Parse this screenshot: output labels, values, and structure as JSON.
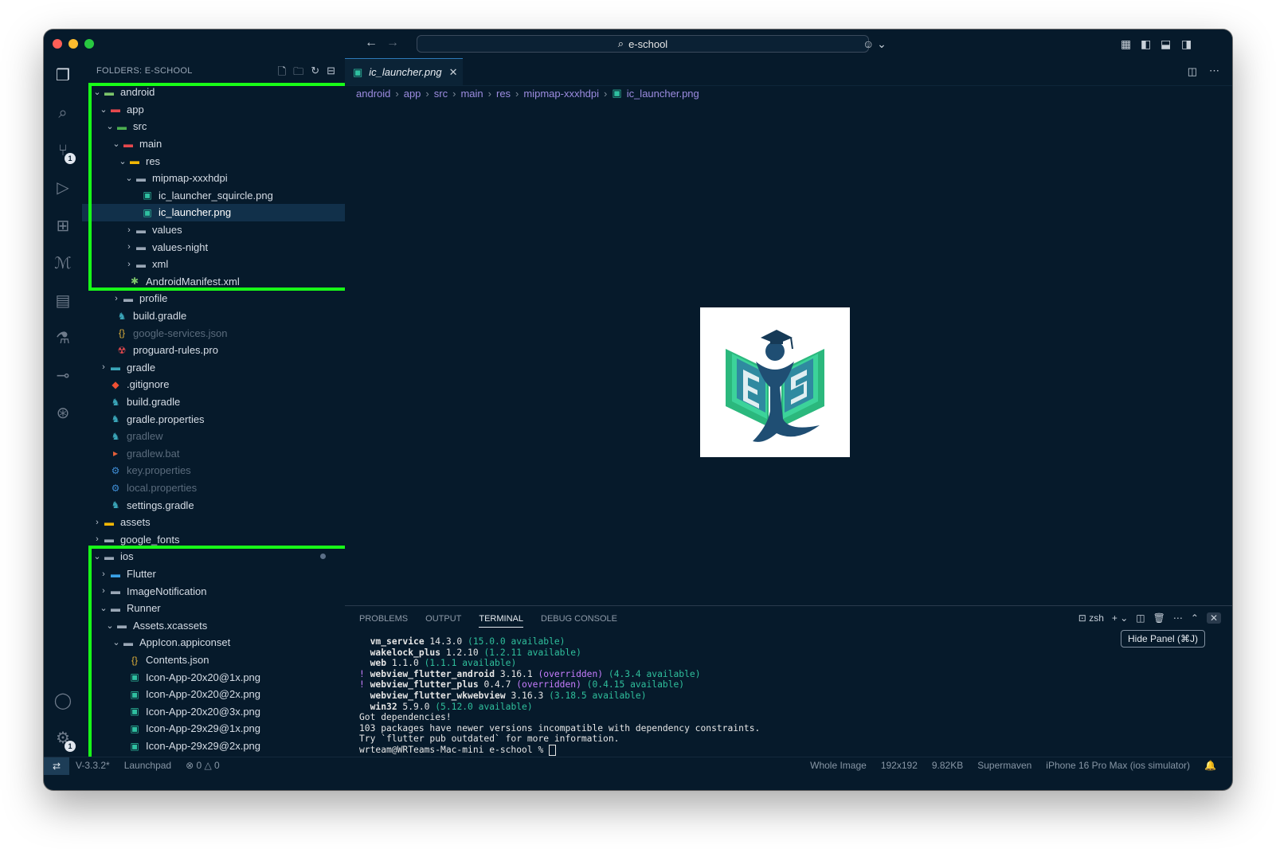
{
  "window": {
    "search_text": "e-school",
    "sidebar_title": "FOLDERS: E-SCHOOL"
  },
  "activity_badges": {
    "scm": "1",
    "settings": "1"
  },
  "tree": [
    {
      "label": "android",
      "depth": 0,
      "chev": "open",
      "icon": "folder-android-icon",
      "color": "#d6dde6"
    },
    {
      "label": "app",
      "depth": 1,
      "chev": "open",
      "icon": "folder-app-icon",
      "color": "#d6dde6"
    },
    {
      "label": "src",
      "depth": 2,
      "chev": "open",
      "icon": "folder-src-icon",
      "color": "#d6dde6"
    },
    {
      "label": "main",
      "depth": 3,
      "chev": "open",
      "icon": "folder-main-icon",
      "color": "#d6dde6"
    },
    {
      "label": "res",
      "depth": 4,
      "chev": "open",
      "icon": "folder-res-icon",
      "color": "#d6dde6"
    },
    {
      "label": "mipmap-xxxhdpi",
      "depth": 5,
      "chev": "open",
      "icon": "folder-icon",
      "color": "#d6dde6"
    },
    {
      "label": "ic_launcher_squircle.png",
      "depth": 6,
      "chev": "none",
      "icon": "image-file-icon",
      "color": "#d6dde6"
    },
    {
      "label": "ic_launcher.png",
      "depth": 6,
      "chev": "none",
      "icon": "image-file-icon",
      "color": "#ffffff",
      "selected": true
    },
    {
      "label": "values",
      "depth": 5,
      "chev": "closed",
      "icon": "folder-icon",
      "color": "#d6dde6"
    },
    {
      "label": "values-night",
      "depth": 5,
      "chev": "closed",
      "icon": "folder-icon",
      "color": "#d6dde6"
    },
    {
      "label": "xml",
      "depth": 5,
      "chev": "closed",
      "icon": "folder-icon",
      "color": "#d6dde6"
    },
    {
      "label": "AndroidManifest.xml",
      "depth": 4,
      "chev": "none",
      "icon": "android-icon",
      "color": "#d6dde6"
    },
    {
      "label": "profile",
      "depth": 3,
      "chev": "closed",
      "icon": "folder-icon",
      "color": "#d6dde6"
    },
    {
      "label": "build.gradle",
      "depth": 2,
      "chev": "none",
      "icon": "gradle-icon",
      "color": "#d6dde6"
    },
    {
      "label": "google-services.json",
      "depth": 2,
      "chev": "none",
      "icon": "json-icon",
      "color": "#5a6b7c"
    },
    {
      "label": "proguard-rules.pro",
      "depth": 2,
      "chev": "none",
      "icon": "proguard-icon",
      "color": "#d6dde6"
    },
    {
      "label": "gradle",
      "depth": 1,
      "chev": "closed",
      "icon": "folder-gradle-icon",
      "color": "#d6dde6"
    },
    {
      "label": ".gitignore",
      "depth": 1,
      "chev": "none",
      "icon": "git-icon",
      "color": "#d6dde6"
    },
    {
      "label": "build.gradle",
      "depth": 1,
      "chev": "none",
      "icon": "gradle-icon",
      "color": "#d6dde6"
    },
    {
      "label": "gradle.properties",
      "depth": 1,
      "chev": "none",
      "icon": "gradle-icon",
      "color": "#d6dde6"
    },
    {
      "label": "gradlew",
      "depth": 1,
      "chev": "none",
      "icon": "gradle-icon",
      "color": "#5a6b7c"
    },
    {
      "label": "gradlew.bat",
      "depth": 1,
      "chev": "none",
      "icon": "terminal-file-icon",
      "color": "#5a6b7c"
    },
    {
      "label": "key.properties",
      "depth": 1,
      "chev": "none",
      "icon": "settings-file-icon",
      "color": "#5a6b7c"
    },
    {
      "label": "local.properties",
      "depth": 1,
      "chev": "none",
      "icon": "settings-file-icon",
      "color": "#5a6b7c"
    },
    {
      "label": "settings.gradle",
      "depth": 1,
      "chev": "none",
      "icon": "gradle-icon",
      "color": "#d6dde6"
    },
    {
      "label": "assets",
      "depth": 0,
      "chev": "closed",
      "icon": "folder-assets-icon",
      "color": "#d6dde6"
    },
    {
      "label": "google_fonts",
      "depth": 0,
      "chev": "closed",
      "icon": "folder-icon",
      "color": "#d6dde6"
    },
    {
      "label": "ios",
      "depth": 0,
      "chev": "open",
      "icon": "folder-ios-icon",
      "color": "#d6dde6",
      "dot": true
    },
    {
      "label": "Flutter",
      "depth": 1,
      "chev": "closed",
      "icon": "folder-flutter-icon",
      "color": "#d6dde6"
    },
    {
      "label": "ImageNotification",
      "depth": 1,
      "chev": "closed",
      "icon": "folder-icon",
      "color": "#d6dde6"
    },
    {
      "label": "Runner",
      "depth": 1,
      "chev": "open",
      "icon": "folder-icon",
      "color": "#d6dde6"
    },
    {
      "label": "Assets.xcassets",
      "depth": 2,
      "chev": "open",
      "icon": "folder-icon",
      "color": "#d6dde6"
    },
    {
      "label": "AppIcon.appiconset",
      "depth": 3,
      "chev": "open",
      "icon": "folder-icon",
      "color": "#d6dde6"
    },
    {
      "label": "Contents.json",
      "depth": 4,
      "chev": "none",
      "icon": "json-icon",
      "color": "#d6dde6"
    },
    {
      "label": "Icon-App-20x20@1x.png",
      "depth": 4,
      "chev": "none",
      "icon": "image-file-icon",
      "color": "#d6dde6"
    },
    {
      "label": "Icon-App-20x20@2x.png",
      "depth": 4,
      "chev": "none",
      "icon": "image-file-icon",
      "color": "#d6dde6"
    },
    {
      "label": "Icon-App-20x20@3x.png",
      "depth": 4,
      "chev": "none",
      "icon": "image-file-icon",
      "color": "#d6dde6"
    },
    {
      "label": "Icon-App-29x29@1x.png",
      "depth": 4,
      "chev": "none",
      "icon": "image-file-icon",
      "color": "#d6dde6"
    },
    {
      "label": "Icon-App-29x29@2x.png",
      "depth": 4,
      "chev": "none",
      "icon": "image-file-icon",
      "color": "#d6dde6"
    }
  ],
  "editor": {
    "tab_label": "ic_launcher.png",
    "breadcrumb": [
      "android",
      "app",
      "src",
      "main",
      "res",
      "mipmap-xxxhdpi",
      "ic_launcher.png"
    ]
  },
  "panel": {
    "tabs": [
      "PROBLEMS",
      "OUTPUT",
      "TERMINAL",
      "DEBUG CONSOLE"
    ],
    "active_tab": "TERMINAL",
    "shell": "zsh",
    "tooltip": "Hide Panel (⌘J)",
    "terminal_lines": [
      {
        "prefix": "  ",
        "pkg": "vm_service",
        "ver": " 14.3.0 ",
        "over": "",
        "avail": "(15.0.0 available)"
      },
      {
        "prefix": "  ",
        "pkg": "wakelock_plus",
        "ver": " 1.2.10 ",
        "over": "",
        "avail": "(1.2.11 available)"
      },
      {
        "prefix": "  ",
        "pkg": "web",
        "ver": " 1.1.0 ",
        "over": "",
        "avail": "(1.1.1 available)"
      },
      {
        "prefix": "! ",
        "pkg": "webview_flutter_android",
        "ver": " 3.16.1 ",
        "over": "(overridden) ",
        "avail": "(4.3.4 available)"
      },
      {
        "prefix": "! ",
        "pkg": "webview_flutter_plus",
        "ver": " 0.4.7 ",
        "over": "(overridden) ",
        "avail": "(0.4.15 available)"
      },
      {
        "prefix": "  ",
        "pkg": "webview_flutter_wkwebview",
        "ver": " 3.16.3 ",
        "over": "",
        "avail": "(3.18.5 available)"
      },
      {
        "prefix": "  ",
        "pkg": "win32",
        "ver": " 5.9.0 ",
        "over": "",
        "avail": "(5.12.0 available)"
      }
    ],
    "plain_lines": [
      "Got dependencies!",
      "103 packages have newer versions incompatible with dependency constraints.",
      "Try `flutter pub outdated` for more information.",
      "wrteam@WRTeams-Mac-mini e-school % "
    ]
  },
  "status": {
    "left": [
      "V-3.3.2*",
      "Launchpad",
      "⊗ 0 △ 0"
    ],
    "right": [
      "Whole Image",
      "192x192",
      "9.82KB",
      "Supermaven",
      "iPhone 16 Pro Max (ios simulator)"
    ]
  },
  "colors": {
    "accent": "#2d7ab8",
    "highlight_box": "#18ff18",
    "bg": "#061a2b"
  }
}
